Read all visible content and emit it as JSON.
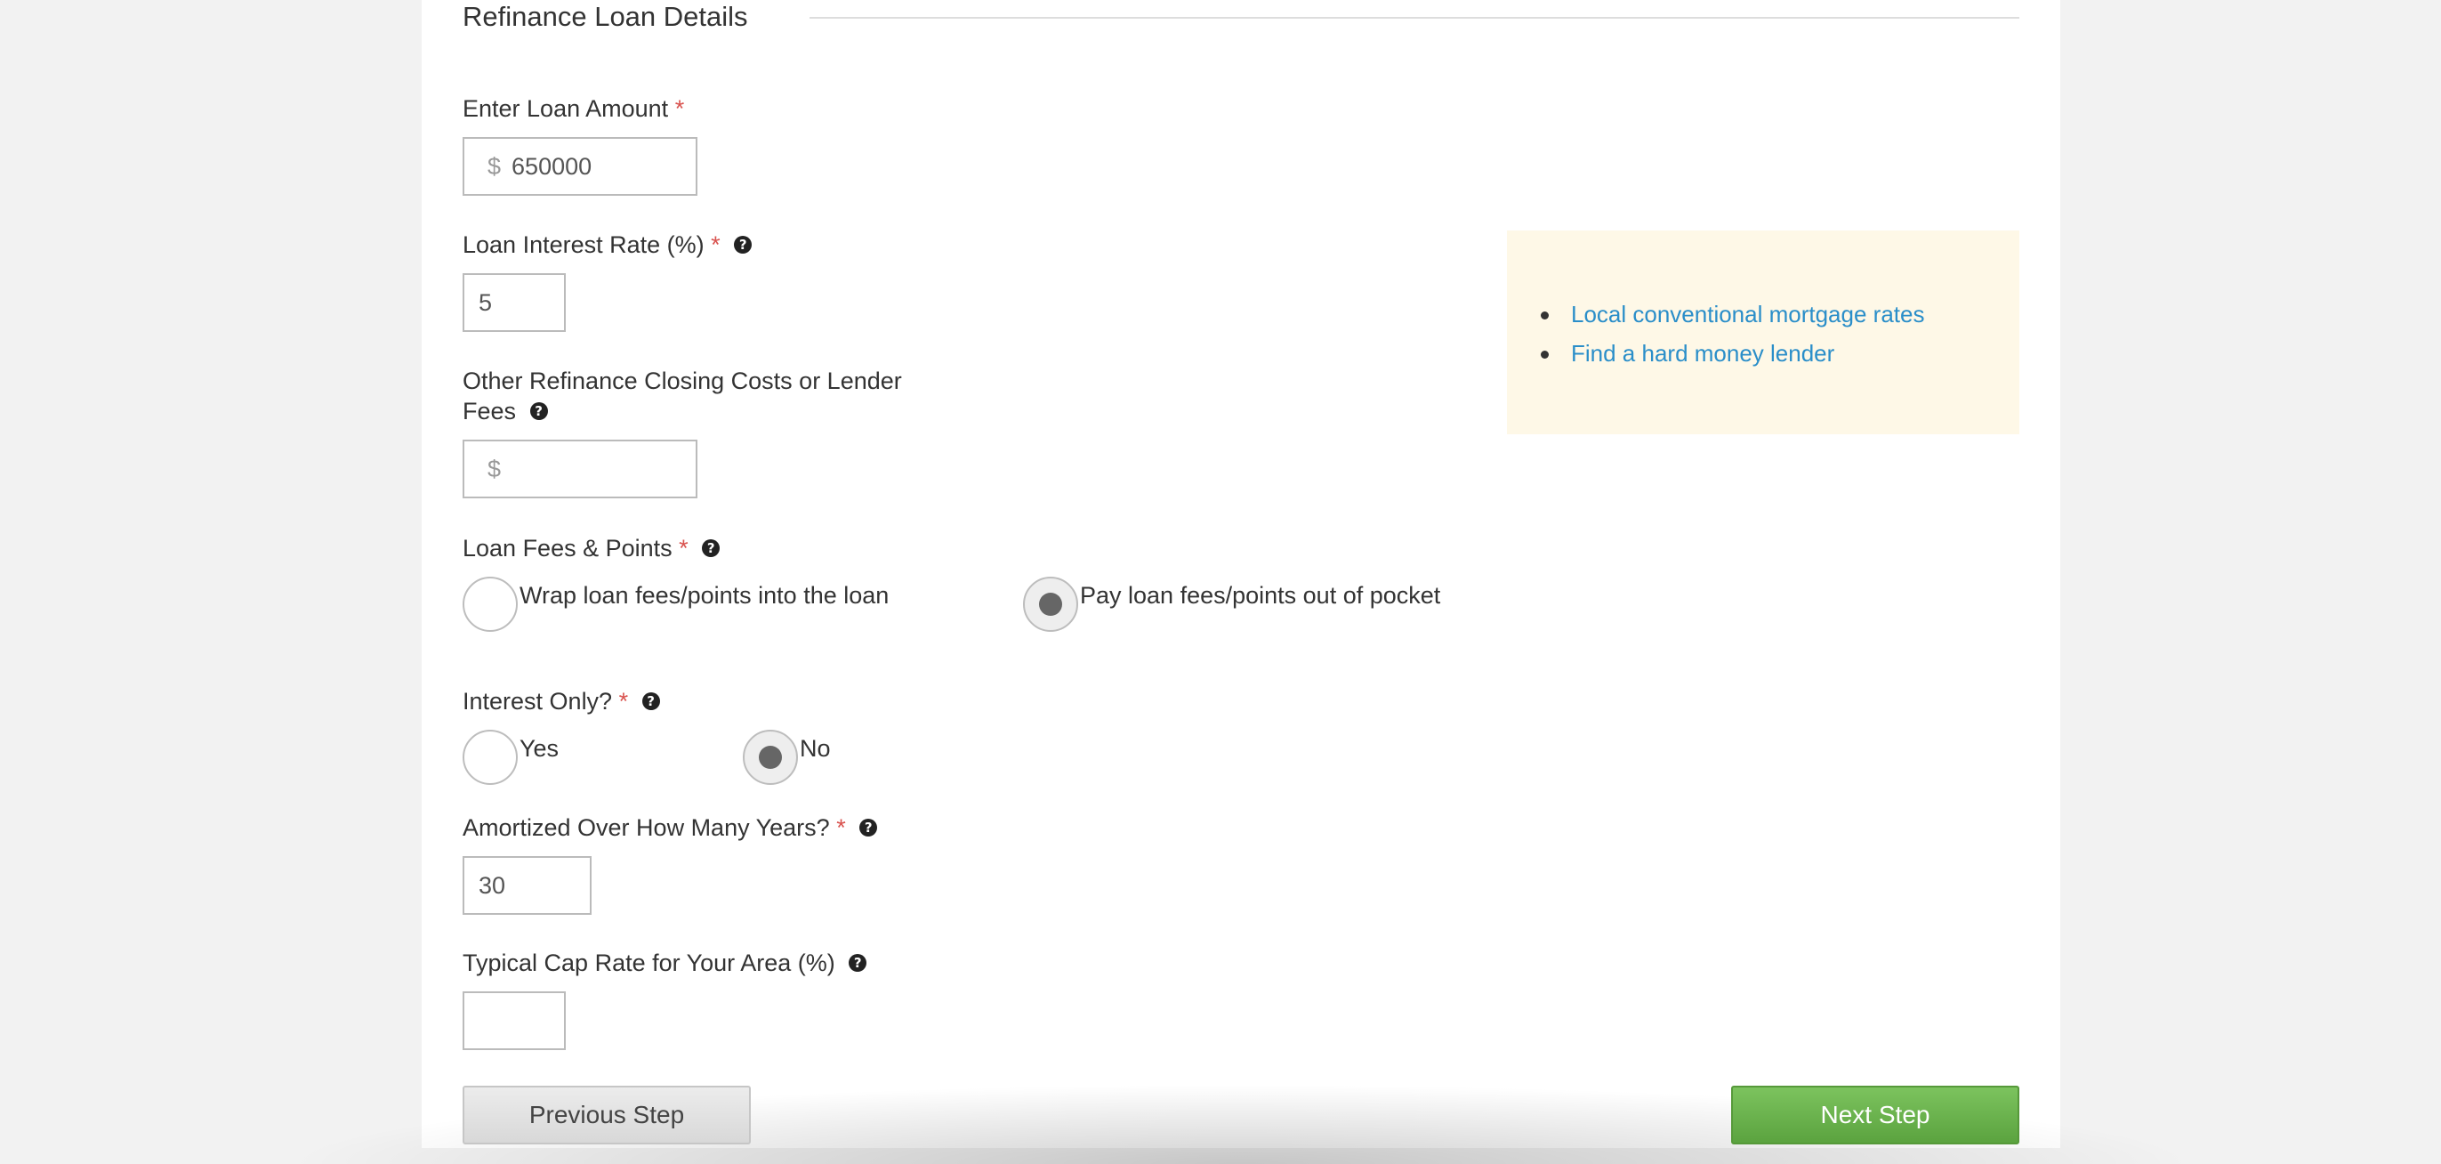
{
  "section": {
    "title": "Refinance Loan Details"
  },
  "fields": {
    "loan_amount": {
      "label": "Enter Loan Amount",
      "required": "*",
      "prefix": "$",
      "value": "650000"
    },
    "interest_rate": {
      "label": "Loan Interest Rate (%)",
      "required": "*",
      "value": "5"
    },
    "closing_costs": {
      "label_line1": "Other Refinance Closing Costs or Lender",
      "label_line2": "Fees",
      "prefix": "$",
      "value": ""
    },
    "fees_points": {
      "label": "Loan Fees & Points",
      "required": "*",
      "options": [
        {
          "label": "Wrap loan fees/points into the loan",
          "checked": false
        },
        {
          "label": "Pay loan fees/points out of pocket",
          "checked": true
        }
      ]
    },
    "interest_only": {
      "label": "Interest Only?",
      "required": "*",
      "options": [
        {
          "label": "Yes",
          "checked": false
        },
        {
          "label": "No",
          "checked": true
        }
      ]
    },
    "amortized_years": {
      "label": "Amortized Over How Many Years?",
      "required": "*",
      "value": "30"
    },
    "cap_rate": {
      "label": "Typical Cap Rate for Your Area (%)",
      "value": ""
    }
  },
  "help_icon_glyph": "?",
  "sidebar_links": [
    {
      "label": "Local conventional mortgage rates"
    },
    {
      "label": "Find a hard money lender"
    }
  ],
  "buttons": {
    "previous": "Previous Step",
    "next": "Next Step"
  },
  "colors": {
    "required": "#d9534f",
    "link": "#2a8ec9",
    "info_bg": "#fef8e7",
    "next_button": "#6ab34d"
  },
  "icons": {
    "help": "question-circle-icon"
  }
}
